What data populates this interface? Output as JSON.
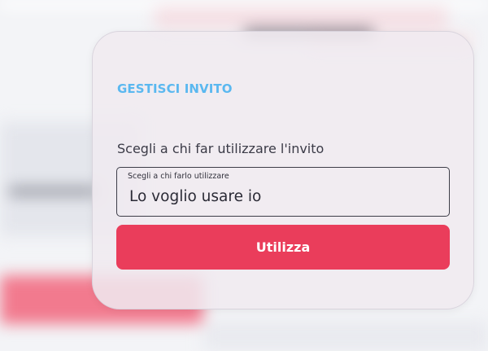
{
  "dialog": {
    "title": "GESTISCI INVITO",
    "question_label": "Scegli a chi far utilizzare l'invito",
    "select": {
      "caption": "Scegli a chi farlo utilizzare",
      "value": "Lo voglio usare io"
    },
    "submit_label": "Utilizza"
  },
  "colors": {
    "title": "#5ab8f0",
    "button": "#ea3d5b",
    "button_text": "#ffffff",
    "text": "#3b3b47"
  }
}
